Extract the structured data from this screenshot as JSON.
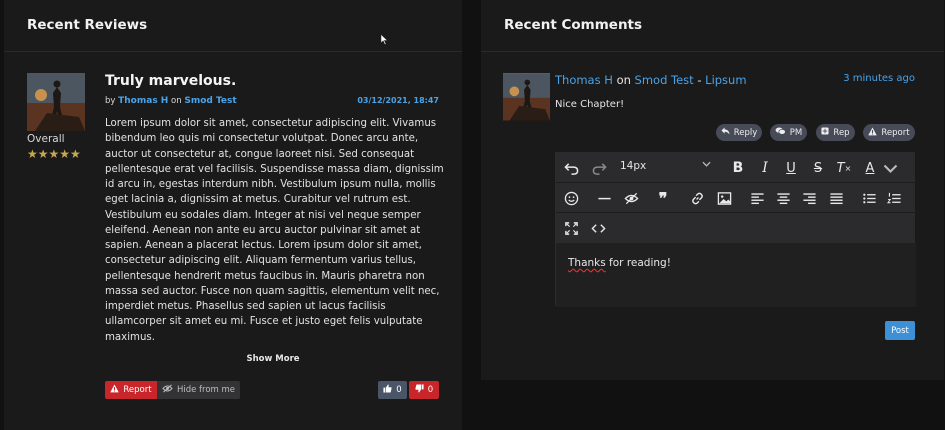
{
  "reviews": {
    "header": "Recent Reviews",
    "overall_label": "Overall",
    "stars": "★★★★★",
    "rating": 5,
    "title": "Truly marvelous.",
    "by_label": "by",
    "author": "Thomas H",
    "on_label": "on",
    "series": "Smod Test",
    "date": "03/12/2021, 18:47",
    "body": "Lorem ipsum dolor sit amet, consectetur adipiscing elit. Vivamus\nbibendum leo quis mi consectetur volutpat. Donec arcu ante,\nauctor ut consectetur at, congue laoreet nisi. Sed consequat\npellentesque erat vel facilisis. Suspendisse massa diam, dignissim\nid arcu in, egestas interdum nibh. Vestibulum ipsum nulla, mollis\neget lacinia a, dignissim at metus. Curabitur vel rutrum est.\nVestibulum eu sodales diam. Integer at nisi vel neque semper\neleifend. Aenean non ante eu arcu auctor pulvinar sit amet at\nsapien. Aenean a placerat lectus. Lorem ipsum dolor sit amet,\nconsectetur adipiscing elit. Aliquam fermentum varius tellus,\npellentesque hendrerit metus faucibus in. Mauris pharetra non\nmassa sed auctor. Fusce non quam sagittis, elementum velit nec,\nimperdiet metus. Phasellus sed sapien ut lacus facilisis\nullamcorper sit amet eu mi. Fusce et justo eget felis vulputate\nmaximus.",
    "show_more": "Show More",
    "report_label": "Report",
    "hide_label": "Hide from me",
    "upvotes": "0",
    "downvotes": "0"
  },
  "comments": {
    "header": "Recent Comments",
    "author": "Thomas H",
    "on_label": "on",
    "series": "Smod Test",
    "dash": "-",
    "chapter": "Lipsum",
    "time": "3 minutes ago",
    "text": "Nice Chapter!",
    "actions": {
      "reply": "Reply",
      "pm": "PM",
      "rep": "Rep",
      "report": "Report"
    },
    "editor": {
      "font_size": "14px",
      "content_first": "Thanks",
      "content_rest": " for reading!"
    },
    "post_label": "Post"
  },
  "colors": {
    "accent": "#4aa3e8",
    "danger": "#c8262b",
    "star": "#c8a74e",
    "post": "#3d8fd6"
  }
}
